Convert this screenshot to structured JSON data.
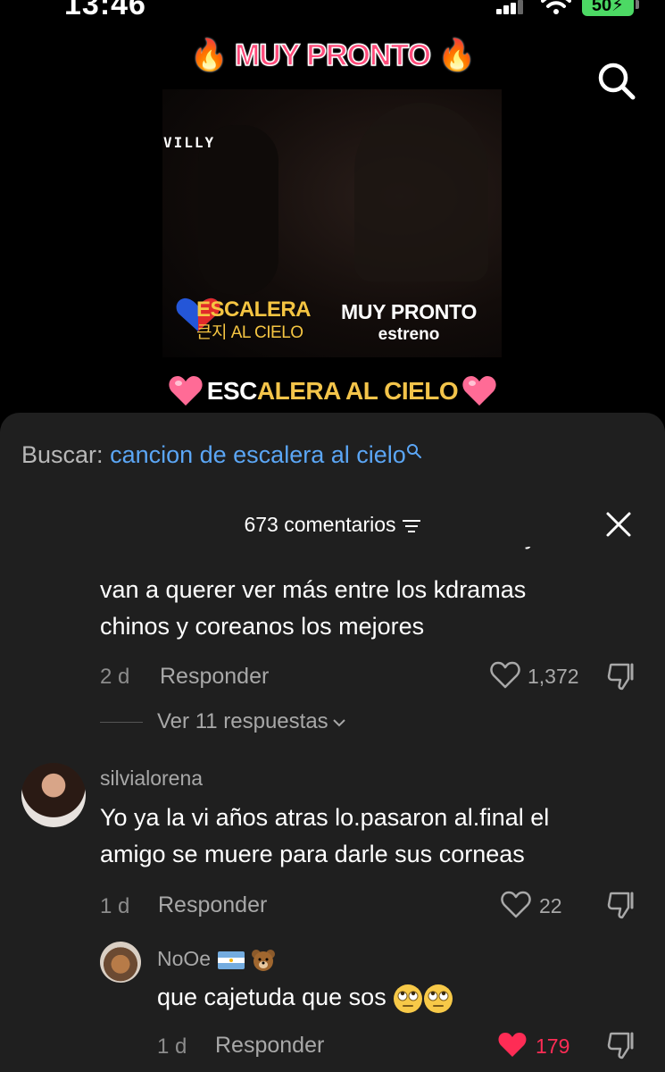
{
  "status": {
    "time": "13:46",
    "battery": "50"
  },
  "video": {
    "top_title": "🔥 MUY PRONTO 🔥",
    "watermark": "VILLY",
    "logo_line1": "ESCALERA",
    "logo_line2": "큰지 AL CIELO",
    "promo_line1": "MUY PRONTO",
    "promo_line2": "estreno",
    "bottom_title_a": "ESC",
    "bottom_title_b": "ALERA AL CIELO"
  },
  "panel": {
    "search_label": "Buscar:",
    "search_query": "cancion de escalera al cielo",
    "comment_count": "673 comentarios"
  },
  "comments": [
    {
      "text_cut": "tercas años al fin van a ver esta novela y",
      "text_line2": "van a querer ver más entre los kdramas",
      "text_line3": "chinos y coreanos los mejores",
      "age": "2 d",
      "reply_label": "Responder",
      "likes": "1,372",
      "view_replies": "Ver 11 respuestas"
    },
    {
      "username": "silvialorena",
      "text_line1": "Yo ya la vi años atras lo.pasaron al.final el",
      "text_line2": "amigo se muere para darle sus corneas",
      "age": "1 d",
      "reply_label": "Responder",
      "likes": "22"
    },
    {
      "username": "NoOe",
      "text": "que cajetuda que sos",
      "age": "1 d",
      "reply_label": "Responder",
      "likes": "179"
    }
  ],
  "colors": {
    "link": "#5ba6f5",
    "liked": "#fe2c55",
    "panel": "#1f1f1f"
  }
}
